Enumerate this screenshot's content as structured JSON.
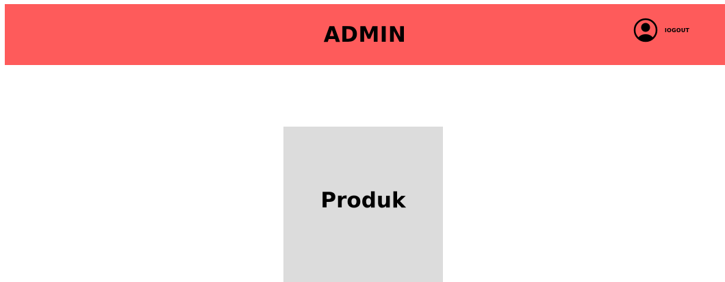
{
  "header": {
    "title": "ADMIN",
    "background_color": "#fe5b5b",
    "user": {
      "avatar_icon": "user-avatar-icon",
      "logout_label": "lOGOUT"
    }
  },
  "main": {
    "cards": [
      {
        "label": "Produk",
        "background_color": "#dcdcdc"
      }
    ]
  }
}
